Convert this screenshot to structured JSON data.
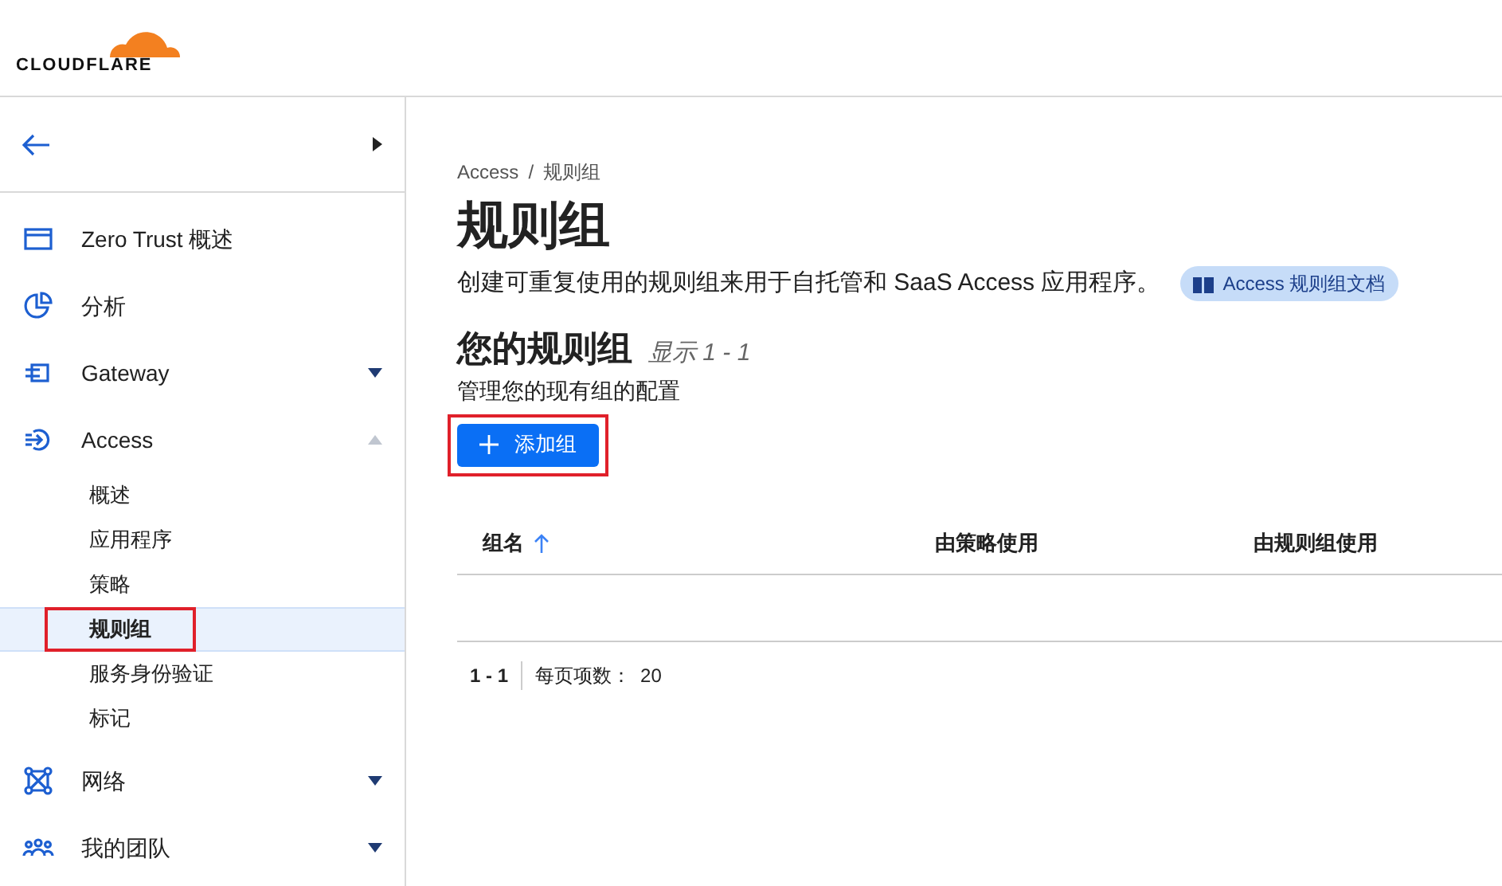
{
  "logo": {
    "text": "CLOUDFLARE"
  },
  "sidebar": {
    "items": [
      {
        "label": "Zero Trust 概述"
      },
      {
        "label": "分析"
      },
      {
        "label": "Gateway",
        "expanded": false
      },
      {
        "label": "Access",
        "expanded": true,
        "children": [
          {
            "label": "概述",
            "selected": false
          },
          {
            "label": "应用程序",
            "selected": false
          },
          {
            "label": "策略",
            "selected": false
          },
          {
            "label": "规则组",
            "selected": true
          },
          {
            "label": "服务身份验证",
            "selected": false
          },
          {
            "label": "标记",
            "selected": false
          }
        ]
      },
      {
        "label": "网络",
        "expanded": false
      },
      {
        "label": "我的团队",
        "expanded": false
      }
    ]
  },
  "breadcrumb": [
    "Access",
    "/",
    "规则组"
  ],
  "title": "规则组",
  "description": "创建可重复使用的规则组来用于自托管和 SaaS Access 应用程序。",
  "docs_link": "Access 规则组文档",
  "section": {
    "title": "您的规则组",
    "count": "显示 1 - 1",
    "subtitle": "管理您的现有组的配置"
  },
  "add_button": "添加组",
  "table": {
    "columns": [
      {
        "label": "组名",
        "sorted": true
      },
      {
        "label": "由策略使用",
        "sorted": false
      },
      {
        "label": "由规则组使用",
        "sorted": false
      }
    ]
  },
  "pagination": {
    "range": "1 - 1",
    "per_page_label": "每页项数：",
    "per_page": "20"
  }
}
